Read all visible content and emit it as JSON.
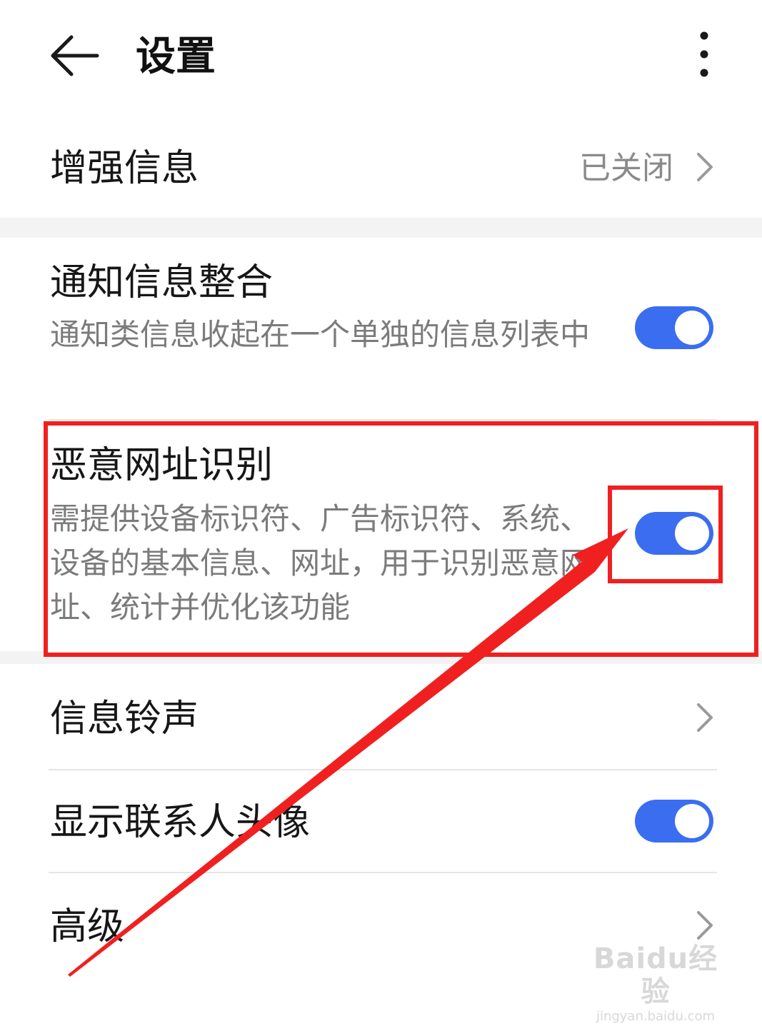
{
  "header": {
    "title": "设置",
    "back_icon": "arrow-left-icon",
    "more_icon": "more-vertical-icon"
  },
  "items": [
    {
      "title": "增强信息",
      "value": "已关闭",
      "control": "chevron"
    },
    {
      "title": "通知信息整合",
      "description": "通知类信息收起在一个单独的信息列表中",
      "control": "toggle",
      "toggle_on": true
    },
    {
      "title": "恶意网址识别",
      "description": "需提供设备标识符、广告标识符、系统、设备的基本信息、网址，用于识别恶意网址、统计并优化该功能",
      "control": "toggle",
      "toggle_on": true
    },
    {
      "title": "信息铃声",
      "control": "chevron"
    },
    {
      "title": "显示联系人头像",
      "control": "toggle",
      "toggle_on": true
    },
    {
      "title": "高级",
      "control": "chevron"
    }
  ],
  "colors": {
    "toggle_on": "#3a6df0",
    "annotation": "#f02020",
    "description_text": "#7b7b7b",
    "value_text": "#8a8a8a"
  },
  "watermark": {
    "logo": "Baidu经验",
    "url": "jingyan.baidu.com"
  }
}
